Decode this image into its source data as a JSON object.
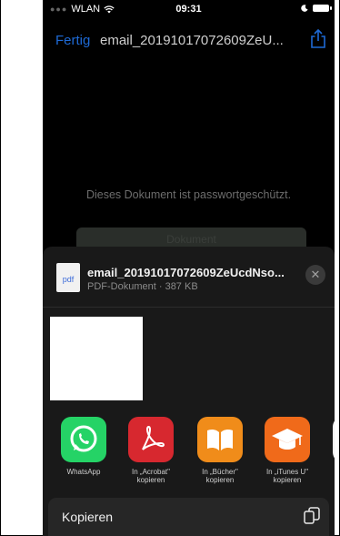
{
  "status_bar": {
    "carrier": "WLAN",
    "time": "09:31"
  },
  "nav": {
    "done_label": "Fertig",
    "title": "email_20191017072609ZeU..."
  },
  "document": {
    "message": "Dieses Dokument ist passwortgeschützt.",
    "unlock_label": "Dokument"
  },
  "share_sheet": {
    "file_name": "email_20191017072609ZeUcdNso...",
    "file_meta": "PDF-Dokument · 387 KB",
    "pdf_badge": "pdf",
    "close_glyph": "✕",
    "apps": [
      {
        "name": "WhatsApp",
        "label": "WhatsApp",
        "color": "#25d366"
      },
      {
        "name": "Acrobat",
        "label": "In „Acrobat\" kopieren",
        "color": "#d7282f"
      },
      {
        "name": "Bücher",
        "label": "In „Bücher\" kopieren",
        "color": "#f08c1a"
      },
      {
        "name": "iTunes U",
        "label": "In „iTunes U\" kopieren",
        "color": "#f06a1a"
      }
    ],
    "copy_label": "Kopieren"
  },
  "colors": {
    "accent": "#1e6ad6",
    "sheet_bg": "#191919"
  }
}
